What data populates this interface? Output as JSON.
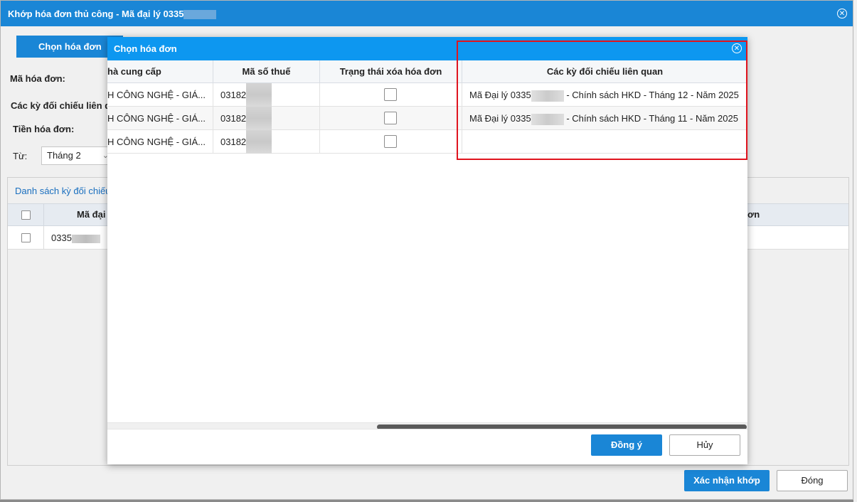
{
  "outer": {
    "title_prefix": "Khớp hóa đơn thủ công - Mã đại lý 0335",
    "tab_label": "Chọn hóa đơn",
    "field_invoice_code": "Mã hóa đơn:",
    "field_related_periods": "Các kỳ đối chiếu liên q",
    "field_invoice_amount": "Tiền hóa đơn:",
    "field_from": "Từ:",
    "from_month_value": "Tháng 2",
    "list_title": "Danh sách kỳ đối chiếu",
    "list_col_agent": "Mã đại",
    "list_col_right": "ơn",
    "list_row_agent_prefix": "0335",
    "confirm_button": "Xác nhận khớp",
    "close_button": "Đóng"
  },
  "modal": {
    "title": "Chọn hóa đơn",
    "columns": [
      "hà cung cấp",
      "Mã số thuế",
      "Trạng thái xóa hóa đơn",
      "Các kỳ đối chiếu liên quan"
    ],
    "rows": [
      {
        "provider": "H CÔNG NGHỆ - GIÁ...",
        "tax_prefix": "03182",
        "periods": "Mã Đại lý 0335",
        "periods_suffix": "- Chính sách HKD - Tháng 12 - Năm 2025"
      },
      {
        "provider": "H CÔNG NGHỆ - GIÁ...",
        "tax_prefix": "03182",
        "periods": "Mã Đại lý 0335",
        "periods_suffix": "- Chính sách HKD - Tháng 11 - Năm 2025"
      },
      {
        "provider": "H CÔNG NGHỆ - GIÁ...",
        "tax_prefix": "03182",
        "periods": "",
        "periods_suffix": ""
      }
    ],
    "ok_button": "Đồng ý",
    "cancel_button": "Hủy"
  },
  "icons": {
    "close": "close-circle-icon",
    "dropdown": "chevron-down-icon"
  },
  "colors": {
    "header_blue": "#1a86d6",
    "modal_header_blue": "#0d97f0",
    "highlight_red": "#e0141e"
  }
}
